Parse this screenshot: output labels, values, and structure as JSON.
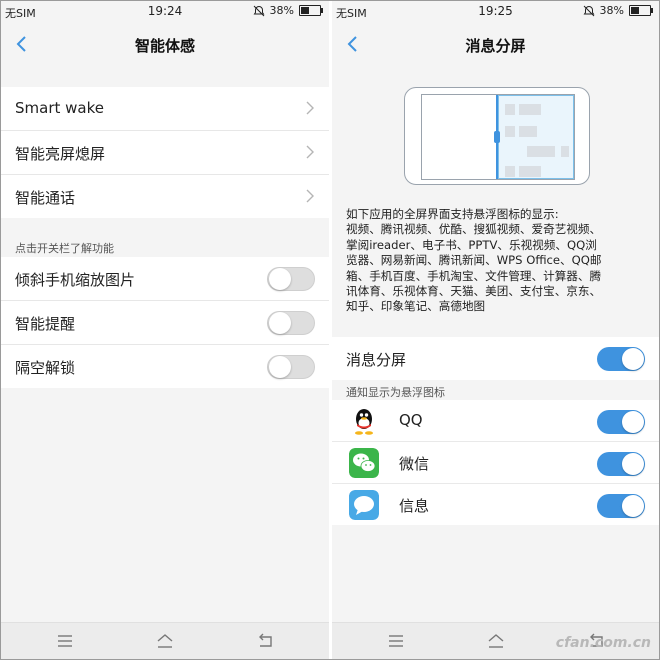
{
  "left": {
    "status": {
      "carrier": "无SIM",
      "time": "19:24",
      "battery": "38%",
      "battery_level": 0.38
    },
    "title": "智能体感",
    "menu_items": [
      {
        "label": "Smart wake"
      },
      {
        "label": "智能亮屏熄屏"
      },
      {
        "label": "智能通话"
      }
    ],
    "section_title": "点击开关栏了解功能",
    "toggle_items": [
      {
        "label": "倾斜手机缩放图片",
        "on": false
      },
      {
        "label": "智能提醒",
        "on": false
      },
      {
        "label": "隔空解锁",
        "on": false
      }
    ]
  },
  "right": {
    "status": {
      "carrier": "无SIM",
      "time": "19:25",
      "battery": "38%",
      "battery_level": 0.38
    },
    "title": "消息分屏",
    "description_lines": [
      "如下应用的全屏界面支持悬浮图标的显示:",
      "视频、腾讯视频、优酷、搜狐视频、爱奇艺视频、",
      "掌阅ireader、电子书、PPTV、乐视视频、QQ浏",
      "览器、网易新闻、腾讯新闻、WPS Office、QQ邮",
      "箱、手机百度、手机淘宝、文件管理、计算器、腾",
      "讯体育、乐视体育、天猫、美团、支付宝、京东、",
      "知乎、印象笔记、高德地图"
    ],
    "main_toggle": {
      "label": "消息分屏",
      "on": true
    },
    "section_title": "通知显示为悬浮图标",
    "apps": [
      {
        "label": "QQ",
        "icon": "qq-icon",
        "on": true
      },
      {
        "label": "微信",
        "icon": "wechat-icon",
        "on": true
      },
      {
        "label": "信息",
        "icon": "messages-icon",
        "on": true
      }
    ]
  },
  "watermark": "cfan.com.cn",
  "colors": {
    "accent": "#3f93df",
    "toggle_off": "#dedede",
    "background": "#f4f4f4"
  }
}
